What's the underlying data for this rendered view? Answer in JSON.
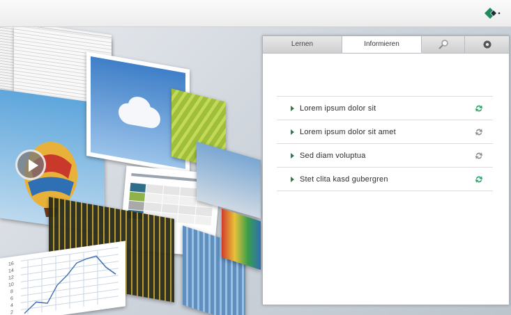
{
  "panel": {
    "tabs": [
      {
        "label": "Lernen"
      },
      {
        "label": "Informieren"
      },
      {
        "icon": "search-icon"
      },
      {
        "icon": "settings-icon"
      }
    ],
    "items": [
      {
        "label": "Lorem ipsum dolor sit",
        "icon": "sync-icon",
        "icon_color": "#2a9e66"
      },
      {
        "label": "Lorem ipsum dolor sit amet",
        "icon": "sync-icon",
        "icon_color": "#8c8c8c"
      },
      {
        "label": "Sed diam voluptua",
        "icon": "sync-icon",
        "icon_color": "#8c8c8c"
      },
      {
        "label": "Stet clita kasd gubergren",
        "icon": "sync-icon",
        "icon_color": "#2a9e66"
      }
    ]
  },
  "colors": {
    "accent": "#2e7d50",
    "logo_green": "#1f8a5b",
    "logo_dark": "#1d2b3a"
  },
  "chart": {
    "y_ticks": [
      "16",
      "14",
      "12",
      "10",
      "8",
      "6",
      "4",
      "2"
    ]
  }
}
